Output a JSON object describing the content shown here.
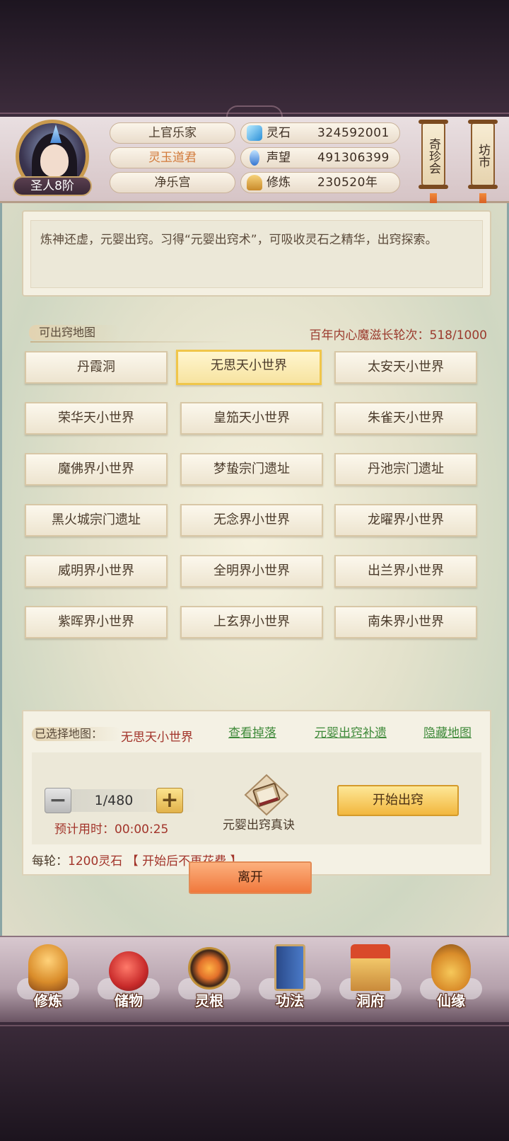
{
  "header": {
    "rank": "圣人8阶",
    "names": [
      "上官乐家",
      "灵玉道君",
      "净乐宫"
    ],
    "name_highlight_color": "#d27a3a",
    "stats": [
      {
        "icon": "spirit-stone-icon",
        "label": "灵石",
        "value": "324592001"
      },
      {
        "icon": "reputation-icon",
        "label": "声望",
        "value": "491306399"
      },
      {
        "icon": "meditation-icon",
        "label": "修炼",
        "value": "230520年"
      }
    ],
    "shops": [
      "奇珍会",
      "坊市"
    ]
  },
  "description": "炼神还虚，元婴出窍。习得“元婴出窍术”，可吸收灵石之精华，出窍探索。",
  "maps": {
    "section_title": "可出窍地图",
    "counter": "百年内心魔滋长轮次：518/1000",
    "items": [
      "丹霞洞",
      "无思天小世界",
      "太安天小世界",
      "荣华天小世界",
      "皇笳天小世界",
      "朱雀天小世界",
      "魔佛界小世界",
      "梦蛰宗门遗址",
      "丹池宗门遗址",
      "黑火城宗门遗址",
      "无念界小世界",
      "龙曜界小世界",
      "威明界小世界",
      "全明界小世界",
      "出兰界小世界",
      "紫晖界小世界",
      "上玄界小世界",
      "南朱界小世界"
    ],
    "selected_index": 1
  },
  "selection": {
    "label": "已选择地图：",
    "selected_map": "无思天小世界",
    "links": [
      "查看掉落",
      "元婴出窍补遗",
      "隐藏地图"
    ],
    "minus": "−",
    "plus": "+",
    "count": "1/480",
    "eta": "预计用时：00:00:25",
    "item_name": "元婴出窍真诀",
    "start_button": "开始出窍",
    "cost_prefix": "每轮：",
    "cost": "1200灵石 【 开始后不再花费 】"
  },
  "leave_button": "离开",
  "nav": [
    {
      "label": "修炼",
      "icon": "cultivation-icon"
    },
    {
      "label": "储物",
      "icon": "storage-bag-icon"
    },
    {
      "label": "灵根",
      "icon": "spirit-root-icon"
    },
    {
      "label": "功法",
      "icon": "technique-book-icon"
    },
    {
      "label": "洞府",
      "icon": "cave-dwelling-icon"
    },
    {
      "label": "仙缘",
      "icon": "gourd-icon"
    }
  ],
  "colors": {
    "accent_red": "#a2342a",
    "link_green": "#3f8a3a",
    "gold": "#f2b73e",
    "orange": "#f0783c"
  }
}
